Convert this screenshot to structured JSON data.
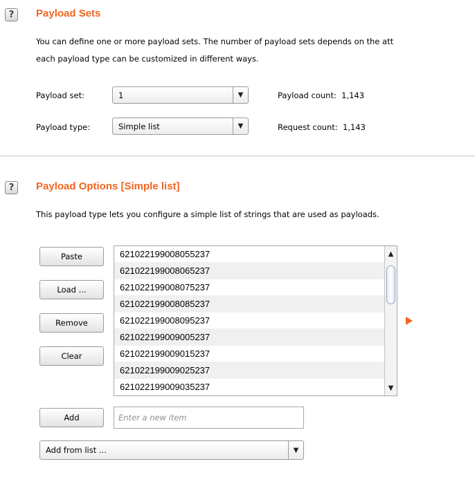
{
  "payload_sets": {
    "title": "Payload Sets",
    "desc_line1": "You can define one or more payload sets. The number of payload sets depends on the att",
    "desc_line2": "each payload type can be customized in different ways.",
    "payload_set_label": "Payload set:",
    "payload_set_value": "1",
    "payload_type_label": "Payload type:",
    "payload_type_value": "Simple list",
    "payload_count_label": "Payload count:",
    "payload_count_value": "1,143",
    "request_count_label": "Request count:",
    "request_count_value": "1,143"
  },
  "payload_options": {
    "title": "Payload Options [Simple list]",
    "desc": "This payload type lets you configure a simple list of strings that are used as payloads.",
    "buttons": {
      "paste": "Paste",
      "load": "Load ...",
      "remove": "Remove",
      "clear": "Clear",
      "add": "Add"
    },
    "items": [
      "621022199008055237",
      "621022199008065237",
      "621022199008075237",
      "621022199008085237",
      "621022199008095237",
      "621022199009005237",
      "621022199009015237",
      "621022199009025237",
      "621022199009035237"
    ],
    "new_item_placeholder": "Enter a new item",
    "add_from_list": "Add from list ..."
  },
  "help_icon_glyph": "?",
  "accent_color": "#f26522"
}
